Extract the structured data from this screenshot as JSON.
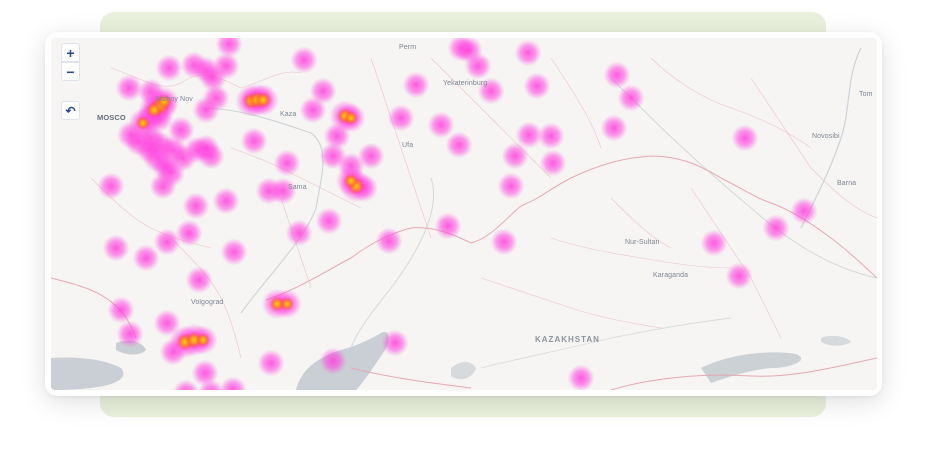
{
  "controls": {
    "zoom_in": "+",
    "zoom_out": "−",
    "reset": "↶"
  },
  "labels": {
    "moscow": "MOSCO",
    "nizhny": "Nizhny Nov",
    "perm": "Perm",
    "yekaterinburg": "Yekaterinburg",
    "kazan": "Kaza",
    "ufa": "Ufa",
    "samara": "Sama",
    "novosibirsk": "Novosibi",
    "tomsk": "Tom",
    "barnaul": "Barna",
    "nur_sultan": "Nur-Sultan",
    "karaganda": "Karaganda",
    "volgograd": "Volgograd",
    "kazakhstan": "KAZAKHSTAN"
  },
  "heatmap": {
    "color_low": "#ff40e0",
    "color_mid": "#ff2a5a",
    "color_high": "#ffd800",
    "points": [
      [
        109,
        68,
        1.0
      ],
      [
        103,
        72,
        0.8
      ],
      [
        113,
        64,
        0.7
      ],
      [
        108,
        80,
        0.5
      ],
      [
        99,
        80,
        0.5
      ],
      [
        92,
        85,
        0.6
      ],
      [
        80,
        97,
        0.5
      ],
      [
        88,
        104,
        0.5
      ],
      [
        100,
        100,
        0.5
      ],
      [
        110,
        108,
        0.5
      ],
      [
        106,
        120,
        0.5
      ],
      [
        98,
        112,
        0.4
      ],
      [
        122,
        112,
        0.5
      ],
      [
        132,
        120,
        0.4
      ],
      [
        120,
        135,
        0.5
      ],
      [
        112,
        148,
        0.4
      ],
      [
        114,
        128,
        0.4
      ],
      [
        130,
        92,
        0.4
      ],
      [
        146,
        112,
        0.4
      ],
      [
        160,
        118,
        0.4
      ],
      [
        155,
        110,
        0.4
      ],
      [
        78,
        50,
        0.4
      ],
      [
        100,
        54,
        0.4
      ],
      [
        118,
        30,
        0.4
      ],
      [
        143,
        27,
        0.4
      ],
      [
        155,
        32,
        0.4
      ],
      [
        162,
        40,
        0.4
      ],
      [
        175,
        28,
        0.4
      ],
      [
        178,
        6,
        0.4
      ],
      [
        200,
        63,
        0.8
      ],
      [
        206,
        62,
        0.9
      ],
      [
        212,
        62,
        0.8
      ],
      [
        165,
        60,
        0.4
      ],
      [
        155,
        72,
        0.4
      ],
      [
        253,
        22,
        0.4
      ],
      [
        272,
        53,
        0.4
      ],
      [
        262,
        72,
        0.4
      ],
      [
        294,
        78,
        0.8
      ],
      [
        300,
        80,
        0.6
      ],
      [
        286,
        98,
        0.4
      ],
      [
        282,
        118,
        0.4
      ],
      [
        300,
        128,
        0.4
      ],
      [
        320,
        118,
        0.4
      ],
      [
        305,
        148,
        0.9
      ],
      [
        300,
        143,
        0.7
      ],
      [
        313,
        150,
        0.5
      ],
      [
        350,
        80,
        0.4
      ],
      [
        365,
        47,
        0.4
      ],
      [
        390,
        87,
        0.4
      ],
      [
        408,
        107,
        0.4
      ],
      [
        410,
        10,
        0.4
      ],
      [
        418,
        12,
        0.4
      ],
      [
        427,
        28,
        0.4
      ],
      [
        440,
        53,
        0.4
      ],
      [
        477,
        15,
        0.4
      ],
      [
        486,
        48,
        0.4
      ],
      [
        464,
        118,
        0.4
      ],
      [
        478,
        97,
        0.4
      ],
      [
        500,
        98,
        0.4
      ],
      [
        502,
        125,
        0.4
      ],
      [
        460,
        148,
        0.4
      ],
      [
        566,
        37,
        0.4
      ],
      [
        580,
        60,
        0.4
      ],
      [
        563,
        90,
        0.4
      ],
      [
        694,
        100,
        0.4
      ],
      [
        753,
        173,
        0.4
      ],
      [
        725,
        190,
        0.4
      ],
      [
        663,
        205,
        0.4
      ],
      [
        688,
        238,
        0.4
      ],
      [
        848,
        98,
        0.4
      ],
      [
        864,
        146,
        0.9
      ],
      [
        868,
        146,
        0.6
      ],
      [
        203,
        103,
        0.4
      ],
      [
        236,
        125,
        0.4
      ],
      [
        218,
        153,
        0.4
      ],
      [
        232,
        153,
        0.4
      ],
      [
        175,
        163,
        0.4
      ],
      [
        145,
        168,
        0.4
      ],
      [
        138,
        195,
        0.4
      ],
      [
        116,
        204,
        0.4
      ],
      [
        95,
        220,
        0.4
      ],
      [
        65,
        210,
        0.4
      ],
      [
        60,
        148,
        0.4
      ],
      [
        183,
        214,
        0.4
      ],
      [
        148,
        242,
        0.4
      ],
      [
        248,
        195,
        0.4
      ],
      [
        278,
        183,
        0.4
      ],
      [
        338,
        203,
        0.4
      ],
      [
        397,
        188,
        0.4
      ],
      [
        453,
        204,
        0.4
      ],
      [
        226,
        266,
        0.7
      ],
      [
        236,
        266,
        0.6
      ],
      [
        70,
        272,
        0.4
      ],
      [
        79,
        296,
        0.4
      ],
      [
        116,
        285,
        0.4
      ],
      [
        134,
        304,
        0.9
      ],
      [
        143,
        302,
        0.9
      ],
      [
        152,
        302,
        0.6
      ],
      [
        122,
        314,
        0.4
      ],
      [
        154,
        335,
        0.4
      ],
      [
        220,
        325,
        0.4
      ],
      [
        282,
        323,
        0.4
      ],
      [
        344,
        305,
        0.4
      ],
      [
        530,
        340,
        0.4
      ],
      [
        135,
        355,
        0.4
      ],
      [
        160,
        355,
        0.4
      ],
      [
        182,
        352,
        0.4
      ]
    ]
  }
}
